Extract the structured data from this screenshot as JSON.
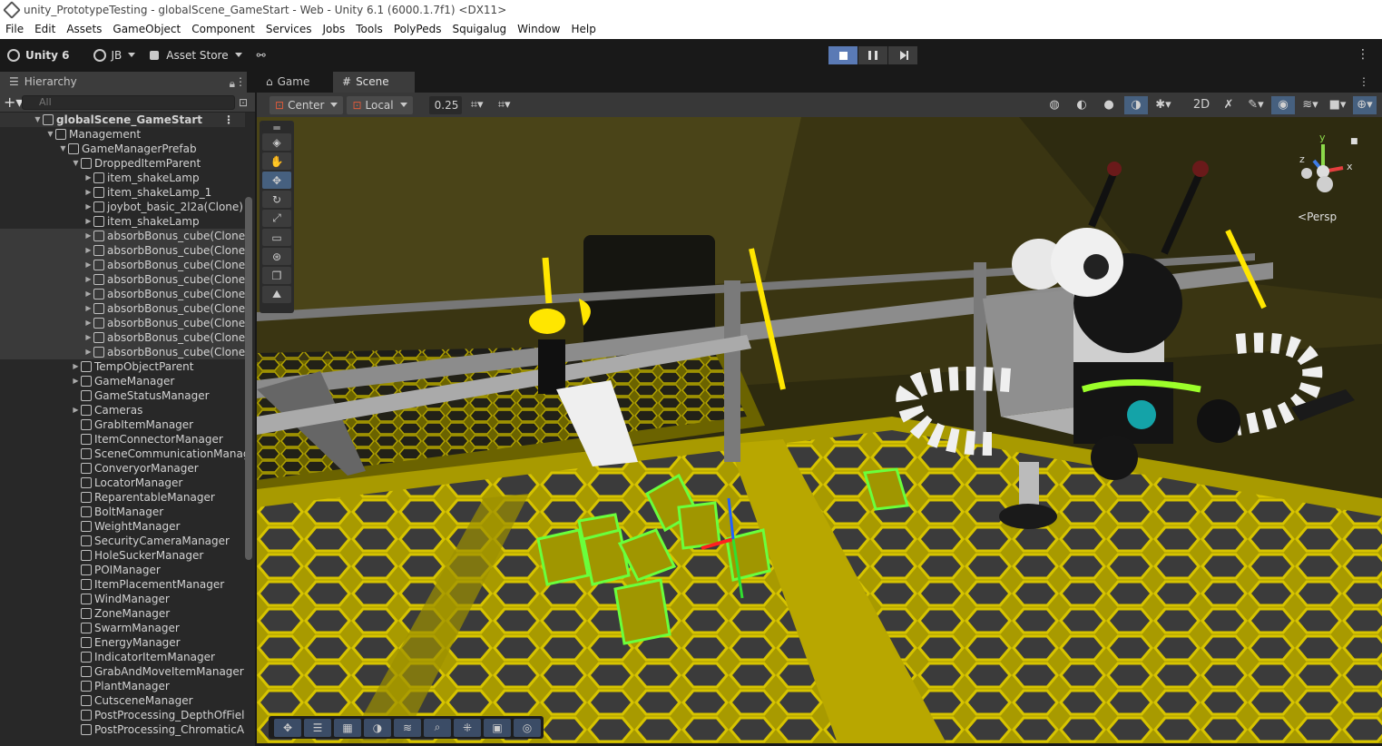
{
  "window": {
    "title": "unity_PrototypeTesting - globalScene_GameStart - Web - Unity 6.1 (6000.1.7f1) <DX11>"
  },
  "menu": [
    "File",
    "Edit",
    "Assets",
    "GameObject",
    "Component",
    "Services",
    "Jobs",
    "Tools",
    "PolyPeds",
    "Squigalug",
    "Window",
    "Help"
  ],
  "toolbar": {
    "unity_label": "Unity 6",
    "account_label": "JB",
    "asset_store_label": "Asset Store"
  },
  "hierarchy": {
    "tab_label": "Hierarchy",
    "search_placeholder": "All",
    "rows": [
      {
        "label": "globalScene_GameStart",
        "indent": 0,
        "type": "scene",
        "arrow": "▼"
      },
      {
        "label": "Management",
        "indent": 1,
        "arrow": "▼"
      },
      {
        "label": "GameManagerPrefab",
        "indent": 2,
        "arrow": "▼"
      },
      {
        "label": "DroppedItemParent",
        "indent": 3,
        "arrow": "▼"
      },
      {
        "label": "item_shakeLamp",
        "indent": 4,
        "arrow": "▶"
      },
      {
        "label": "item_shakeLamp_1",
        "indent": 4,
        "arrow": "▶"
      },
      {
        "label": "joybot_basic_2l2a(Clone)",
        "indent": 4,
        "arrow": "▶"
      },
      {
        "label": "item_shakeLamp",
        "indent": 4,
        "arrow": "▶"
      },
      {
        "label": "absorbBonus_cube(Clone",
        "indent": 4,
        "arrow": "▶",
        "selected": true
      },
      {
        "label": "absorbBonus_cube(Clone",
        "indent": 4,
        "arrow": "▶",
        "selected": true
      },
      {
        "label": "absorbBonus_cube(Clone",
        "indent": 4,
        "arrow": "▶",
        "selected": true
      },
      {
        "label": "absorbBonus_cube(Clone",
        "indent": 4,
        "arrow": "▶",
        "selected": true
      },
      {
        "label": "absorbBonus_cube(Clone",
        "indent": 4,
        "arrow": "▶",
        "selected": true
      },
      {
        "label": "absorbBonus_cube(Clone",
        "indent": 4,
        "arrow": "▶",
        "selected": true
      },
      {
        "label": "absorbBonus_cube(Clone",
        "indent": 4,
        "arrow": "▶",
        "selected": true
      },
      {
        "label": "absorbBonus_cube(Clone",
        "indent": 4,
        "arrow": "▶",
        "selected": true
      },
      {
        "label": "absorbBonus_cube(Clone",
        "indent": 4,
        "arrow": "▶",
        "selected": true
      },
      {
        "label": "TempObjectParent",
        "indent": 3,
        "arrow": "▶"
      },
      {
        "label": "GameManager",
        "indent": 3,
        "arrow": "▶"
      },
      {
        "label": "GameStatusManager",
        "indent": 3,
        "arrow": ""
      },
      {
        "label": "Cameras",
        "indent": 3,
        "arrow": "▶"
      },
      {
        "label": "GrabItemManager",
        "indent": 3,
        "arrow": ""
      },
      {
        "label": "ItemConnectorManager",
        "indent": 3,
        "arrow": ""
      },
      {
        "label": "SceneCommunicationManag",
        "indent": 3,
        "arrow": ""
      },
      {
        "label": "ConveryorManager",
        "indent": 3,
        "arrow": ""
      },
      {
        "label": "LocatorManager",
        "indent": 3,
        "arrow": ""
      },
      {
        "label": "ReparentableManager",
        "indent": 3,
        "arrow": ""
      },
      {
        "label": "BoltManager",
        "indent": 3,
        "arrow": ""
      },
      {
        "label": "WeightManager",
        "indent": 3,
        "arrow": ""
      },
      {
        "label": "SecurityCameraManager",
        "indent": 3,
        "arrow": ""
      },
      {
        "label": "HoleSuckerManager",
        "indent": 3,
        "arrow": ""
      },
      {
        "label": "POIManager",
        "indent": 3,
        "arrow": ""
      },
      {
        "label": "ItemPlacementManager",
        "indent": 3,
        "arrow": ""
      },
      {
        "label": "WindManager",
        "indent": 3,
        "arrow": ""
      },
      {
        "label": "ZoneManager",
        "indent": 3,
        "arrow": ""
      },
      {
        "label": "SwarmManager",
        "indent": 3,
        "arrow": ""
      },
      {
        "label": "EnergyManager",
        "indent": 3,
        "arrow": ""
      },
      {
        "label": "IndicatorItemManager",
        "indent": 3,
        "arrow": ""
      },
      {
        "label": "GrabAndMoveItemManager",
        "indent": 3,
        "arrow": ""
      },
      {
        "label": "PlantManager",
        "indent": 3,
        "arrow": ""
      },
      {
        "label": "CutsceneManager",
        "indent": 3,
        "arrow": ""
      },
      {
        "label": "PostProcessing_DepthOfFiel",
        "indent": 3,
        "arrow": ""
      },
      {
        "label": "PostProcessing_ChromaticA",
        "indent": 3,
        "arrow": ""
      }
    ]
  },
  "scene_tabs": {
    "game_label": "Game",
    "scene_label": "Scene"
  },
  "scene_toolbar": {
    "pivot_label": "Center",
    "space_label": "Local",
    "snap_value": "0.25"
  },
  "gizmo": {
    "projection_label": "Persp",
    "axis_x": "x",
    "axis_y": "y",
    "axis_z": "z"
  },
  "colors": {
    "accent": "#46607f",
    "floor_yellow": "#c8b400",
    "cube_green": "#5fe23c",
    "background": "#191919"
  }
}
